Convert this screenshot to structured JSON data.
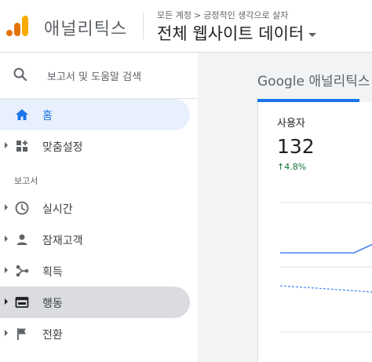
{
  "header": {
    "app_name": "애널리틱스",
    "breadcrumb": {
      "account": "모든 계정",
      "separator": ">",
      "property": "긍정적인 생각으로 살자"
    },
    "view_title": "전체 웹사이트 데이터",
    "logo_colors": [
      "#f9ab00",
      "#e37400"
    ]
  },
  "sidebar": {
    "search_label": "보고서 및 도움말 검색",
    "items": [
      {
        "label": "홈",
        "icon": "home-icon",
        "active": true,
        "expandable": false
      },
      {
        "label": "맞춤설정",
        "icon": "dashboard-grid-icon",
        "expandable": true
      }
    ],
    "section_label": "보고서",
    "reports": [
      {
        "label": "실시간",
        "icon": "clock-icon"
      },
      {
        "label": "잠재고객",
        "icon": "person-icon"
      },
      {
        "label": "획득",
        "icon": "acquisition-icon"
      },
      {
        "label": "행동",
        "icon": "behavior-icon",
        "hovered": true
      },
      {
        "label": "전환",
        "icon": "flag-icon"
      }
    ]
  },
  "main": {
    "tab_title": "Google 애널리틱스",
    "metric": {
      "label": "사용자",
      "value": "132",
      "delta": "↑4.8%"
    },
    "accent_color": "#1a73e8"
  }
}
